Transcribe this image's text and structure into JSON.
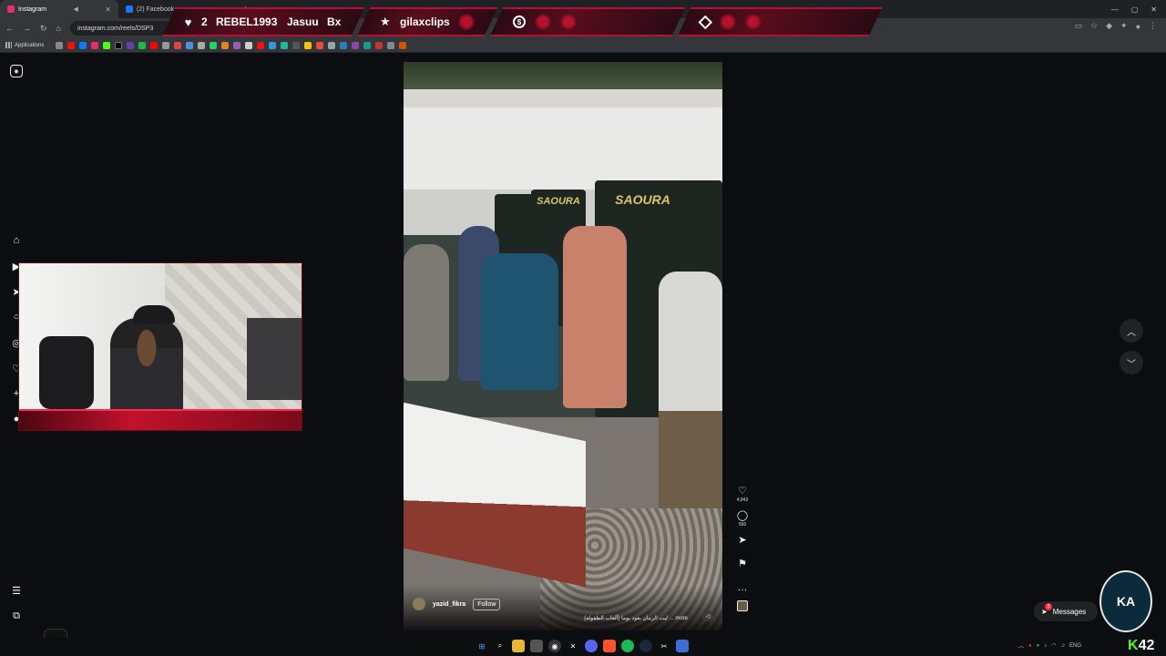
{
  "browser": {
    "tabs": [
      {
        "title": "Instagram",
        "active": true,
        "favicon_color": "#e1306c"
      },
      {
        "title": "(2) Facebook",
        "active": false,
        "favicon_color": "#1877f2"
      }
    ],
    "url": "instagram.com/reels/DSP3",
    "bookmarks_label": "Applications",
    "window_controls": [
      "—",
      "▢",
      "✕"
    ]
  },
  "overlay": {
    "heart_count": "2",
    "names": [
      "REBEL1993",
      "Jasuu",
      "Bx"
    ],
    "highlight": "gilaxclips",
    "accent": "#b0123a"
  },
  "reel": {
    "author": "yazid_fikra",
    "follow_label": "Follow",
    "caption": "ليت الزمان يعود يوما (ألعاب الطفولة) ... more",
    "sign_text": "SAOURA",
    "likes": "4,843",
    "comments": "566"
  },
  "messages": {
    "label": "Messages",
    "badge": "3"
  },
  "streamer_logo_text": "KA",
  "taskbar": {
    "lang": "ENG",
    "kick_number": "42"
  }
}
